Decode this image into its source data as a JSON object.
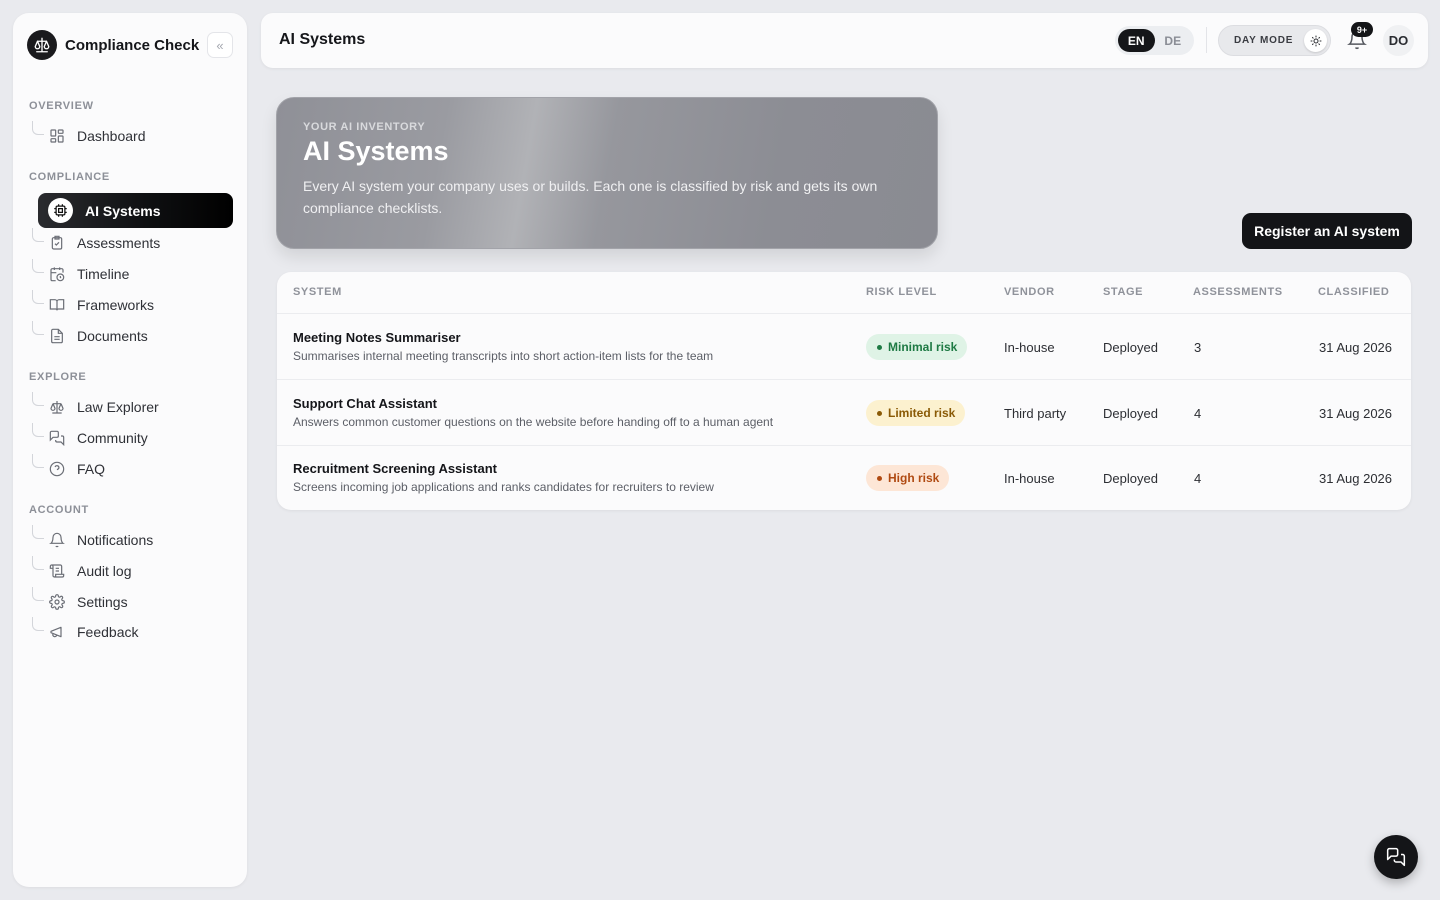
{
  "sidebar": {
    "brand": "Compliance Check",
    "collapse_glyph": "«",
    "sections": [
      {
        "title": "OVERVIEW",
        "items": [
          {
            "label": "Dashboard",
            "icon": "dashboard-icon"
          }
        ]
      },
      {
        "title": "COMPLIANCE",
        "items": [
          {
            "label": "AI Systems",
            "icon": "cpu-icon",
            "active": true
          },
          {
            "label": "Assessments",
            "icon": "clipboard-check-icon"
          },
          {
            "label": "Timeline",
            "icon": "calendar-clock-icon"
          },
          {
            "label": "Frameworks",
            "icon": "book-open-icon"
          },
          {
            "label": "Documents",
            "icon": "document-icon"
          }
        ]
      },
      {
        "title": "EXPLORE",
        "items": [
          {
            "label": "Law Explorer",
            "icon": "scale-icon"
          },
          {
            "label": "Community",
            "icon": "messages-icon"
          },
          {
            "label": "FAQ",
            "icon": "help-circle-icon"
          }
        ]
      },
      {
        "title": "ACCOUNT",
        "items": [
          {
            "label": "Notifications",
            "icon": "bell-icon"
          },
          {
            "label": "Audit log",
            "icon": "scroll-icon"
          },
          {
            "label": "Settings",
            "icon": "gear-icon"
          },
          {
            "label": "Feedback",
            "icon": "megaphone-icon"
          }
        ]
      }
    ]
  },
  "topbar": {
    "title": "AI Systems",
    "lang": {
      "en": "EN",
      "de": "DE",
      "active": "EN"
    },
    "day_mode": "DAY MODE",
    "notifications_badge": "9+",
    "avatar": "DO"
  },
  "hero": {
    "kicker": "YOUR AI INVENTORY",
    "title": "AI Systems",
    "description": "Every AI system your company uses or builds. Each one is classified by risk and gets its own compliance checklists."
  },
  "register_button": "Register an AI system",
  "table": {
    "columns": [
      "SYSTEM",
      "RISK LEVEL",
      "VENDOR",
      "STAGE",
      "ASSESSMENTS",
      "CLASSIFIED"
    ],
    "rows": [
      {
        "name": "Meeting Notes Summariser",
        "desc": "Summarises internal meeting transcripts into short action-item lists for the team",
        "risk": "Minimal risk",
        "vendor": "In-house",
        "stage": "Deployed",
        "assessments": "3",
        "classified": "31 Aug 2026"
      },
      {
        "name": "Support Chat Assistant",
        "desc": "Answers common customer questions on the website before handing off to a human agent",
        "risk": "Limited risk",
        "vendor": "Third party",
        "stage": "Deployed",
        "assessments": "4",
        "classified": "31 Aug 2026"
      },
      {
        "name": "Recruitment Screening Assistant",
        "desc": "Screens incoming job applications and ranks candidates for recruiters to review",
        "risk": "High risk",
        "vendor": "In-house",
        "stage": "Deployed",
        "assessments": "4",
        "classified": "31 Aug 2026"
      }
    ]
  },
  "colors": {
    "minimal_bg": "#dff3e6",
    "minimal_fg": "#1e7a44",
    "limited_bg": "#fcf1cf",
    "limited_fg": "#8a5a06",
    "high_bg": "#fde6d6",
    "high_fg": "#b04a12"
  }
}
